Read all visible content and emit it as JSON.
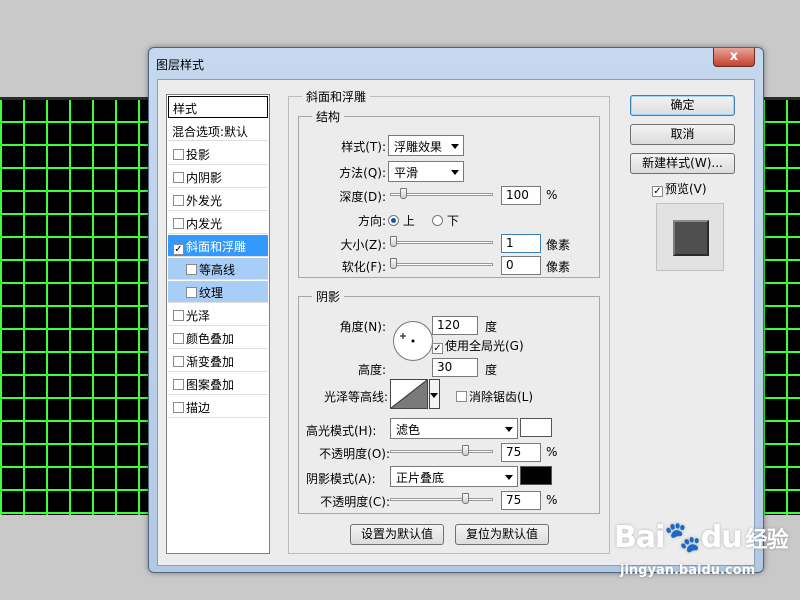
{
  "dialog": {
    "title": "图层样式",
    "close": "x"
  },
  "styles_list": {
    "header": "样式",
    "blend": "混合选项:默认",
    "items": [
      {
        "label": "投影",
        "checked": false
      },
      {
        "label": "内阴影",
        "checked": false
      },
      {
        "label": "外发光",
        "checked": false
      },
      {
        "label": "内发光",
        "checked": false
      },
      {
        "label": "斜面和浮雕",
        "checked": true,
        "selected": true
      },
      {
        "label": "等高线",
        "checked": false,
        "sub": true
      },
      {
        "label": "纹理",
        "checked": false,
        "sub": true
      },
      {
        "label": "光泽",
        "checked": false
      },
      {
        "label": "颜色叠加",
        "checked": false
      },
      {
        "label": "渐变叠加",
        "checked": false
      },
      {
        "label": "图案叠加",
        "checked": false
      },
      {
        "label": "描边",
        "checked": false
      }
    ]
  },
  "bevel": {
    "title": "斜面和浮雕",
    "structure": {
      "title": "结构",
      "style_label": "样式(T):",
      "style_value": "浮雕效果",
      "technique_label": "方法(Q):",
      "technique_value": "平滑",
      "depth_label": "深度(D):",
      "depth_value": "100",
      "depth_unit": "%",
      "depth_level": 0.1,
      "direction_label": "方向:",
      "direction_up": "上",
      "direction_down": "下",
      "size_label": "大小(Z):",
      "size_value": "1",
      "size_unit": "像素",
      "size_level": 0.0,
      "soften_label": "软化(F):",
      "soften_value": "0",
      "soften_unit": "像素",
      "soften_level": 0.0
    },
    "shading": {
      "title": "阴影",
      "angle_label": "角度(N):",
      "angle_value": "120",
      "angle_unit": "度",
      "global_light_label": "使用全局光(G)",
      "global_light": true,
      "altitude_label": "高度:",
      "altitude_value": "30",
      "altitude_unit": "度",
      "gloss_label": "光泽等高线:",
      "antialias_label": "消除锯齿(L)",
      "antialias": false,
      "highlight_mode_label": "高光模式(H):",
      "highlight_mode": "滤色",
      "highlight_color": "#ffffff",
      "highlight_opacity_label": "不透明度(O):",
      "highlight_opacity": "75",
      "highlight_opacity_unit": "%",
      "highlight_opacity_level": 0.75,
      "shadow_mode_label": "阴影模式(A):",
      "shadow_mode": "正片叠底",
      "shadow_color": "#000000",
      "shadow_opacity_label": "不透明度(C):",
      "shadow_opacity": "75",
      "shadow_opacity_unit": "%",
      "shadow_opacity_level": 0.75
    },
    "make_default": "设置为默认值",
    "reset_default": "复位为默认值"
  },
  "buttons": {
    "ok": "确定",
    "cancel": "取消",
    "new_style": "新建样式(W)...",
    "preview_label": "预览(V)",
    "preview": true
  },
  "watermark": {
    "brand": "Bai",
    "brand2": "du",
    "cn": "经验",
    "url": "jingyan.baidu.com"
  },
  "colors": {
    "grid": "#3cff3c",
    "selection": "#3399ff"
  }
}
